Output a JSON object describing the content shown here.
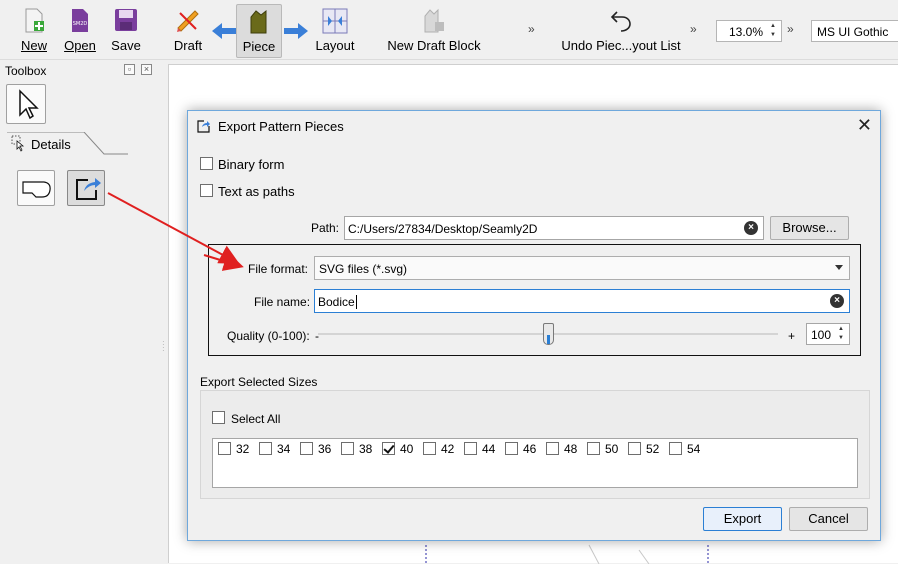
{
  "toolbar": {
    "buttons": [
      {
        "key": "new",
        "label": "New"
      },
      {
        "key": "open",
        "label": "Open"
      },
      {
        "key": "save",
        "label": "Save"
      },
      {
        "key": "draft",
        "label": "Draft"
      },
      {
        "key": "piece",
        "label": "Piece"
      },
      {
        "key": "layout",
        "label": "Layout"
      },
      {
        "key": "new_draft_block",
        "label": "New Draft Block"
      },
      {
        "key": "undo",
        "label": "Undo Piec...yout List"
      }
    ],
    "more_1": "»",
    "more_2": "»",
    "more_3": "»",
    "zoom_value": "13.0%",
    "font_value": "MS UI Gothic"
  },
  "left_panel": {
    "toolbox_title": "Toolbox",
    "details_tab": "Details"
  },
  "dialog": {
    "title": "Export Pattern Pieces",
    "binary_form_label": "Binary form",
    "binary_form_checked": false,
    "text_as_paths_label": "Text as paths",
    "text_as_paths_checked": false,
    "path_label": "Path:",
    "path_value": "C:/Users/27834/Desktop/Seamly2D",
    "browse_label": "Browse...",
    "file_format_label": "File format:",
    "file_format_value": "SVG files (*.svg)",
    "file_name_label": "File name:",
    "file_name_value": "Bodice",
    "quality_label": "Quality (0-100):",
    "quality_minus": "-",
    "quality_plus": "+",
    "quality_value": "100",
    "quality_level_percent": 50,
    "sizes_group_label": "Export Selected Sizes",
    "select_all_label": "Select All",
    "select_all_checked": false,
    "sizes": [
      {
        "label": "32",
        "checked": false
      },
      {
        "label": "34",
        "checked": false
      },
      {
        "label": "36",
        "checked": false
      },
      {
        "label": "38",
        "checked": false
      },
      {
        "label": "40",
        "checked": true
      },
      {
        "label": "42",
        "checked": false
      },
      {
        "label": "44",
        "checked": false
      },
      {
        "label": "46",
        "checked": false
      },
      {
        "label": "48",
        "checked": false
      },
      {
        "label": "50",
        "checked": false
      },
      {
        "label": "52",
        "checked": false
      },
      {
        "label": "54",
        "checked": false
      }
    ],
    "export_label": "Export",
    "cancel_label": "Cancel"
  },
  "colors": {
    "accent_blue": "#2b7fd4",
    "annotation_red": "#e02020",
    "icon_purple": "#7a3e9d",
    "icon_orange": "#f0a020"
  }
}
